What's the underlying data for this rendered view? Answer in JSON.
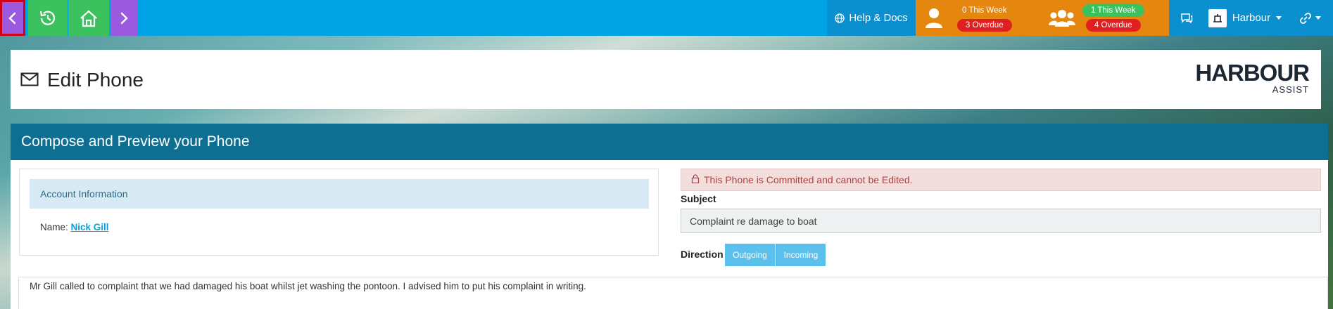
{
  "topbar": {
    "help_label": "Help & Docs",
    "person": {
      "this_week": "0 This Week",
      "overdue": "3 Overdue"
    },
    "group": {
      "this_week": "1 This Week",
      "overdue": "4 Overdue"
    },
    "org_name": "Harbour"
  },
  "header": {
    "title": "Edit Phone",
    "brand_name": "HARBOUR",
    "brand_sub": "ASSIST"
  },
  "compose": {
    "heading": "Compose and Preview your Phone",
    "account_heading": "Account Information",
    "name_label": "Name:",
    "name_value": "Nick Gill",
    "alert": "This Phone is Committed and cannot be Edited.",
    "subject_label": "Subject",
    "subject_value": "Complaint re damage to boat",
    "direction_label": "Direction",
    "direction_options": [
      "Outgoing",
      "Incoming"
    ],
    "message": "Mr Gill called to complaint that we had damaged his boat whilst jet washing the pontoon.  I advised him to put his complaint in writing."
  },
  "colors": {
    "topbar": "#00a4e4",
    "nav_purple": "#9b59e0",
    "nav_green": "#3cc15f",
    "orange": "#e5870e",
    "compose_header": "#0e6f93",
    "alert_bg": "#f3dede"
  }
}
